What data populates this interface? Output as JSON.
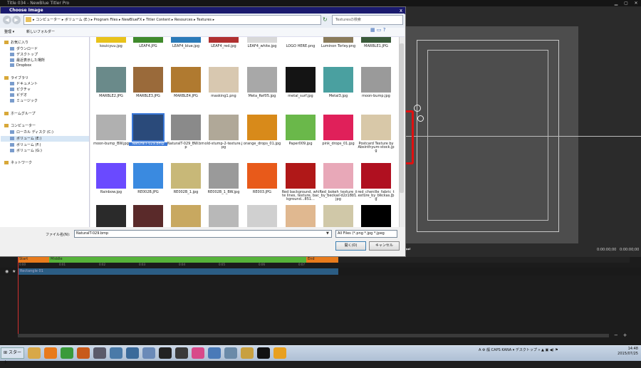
{
  "app": {
    "title": "Title 034 - NewBlue Titler Pro",
    "timecode_1": "0:00:00;00",
    "timecode_2": "0:00:00;00",
    "play_icon": "play-icon",
    "zoom_minus": "−",
    "zoom_plus": "+"
  },
  "timeline": {
    "start_label": "Start",
    "middle_label": "Middle",
    "end_label": "End",
    "ticks": [
      "0:00",
      "0:01",
      "0:02",
      "0:03",
      "0:04",
      "0:05",
      "0:06",
      "0:07"
    ],
    "track_name": "Rectangle 01",
    "track_color": "#2b5d84",
    "start_color": "#e87b1c",
    "middle_color": "#56b33a",
    "end_color": "#e87b1c"
  },
  "dialog": {
    "title": "Choose Image",
    "close": "x",
    "path": "▸ コンピューター ▸ ボリューム (E:) ▸ Program Files ▸ NewBlueFX ▸ Titler Content ▸ Resources ▸ Textures ▸",
    "search_placeholder": "Texturesの検索",
    "organize": "整理 ▾",
    "new_folder": "新しいフォルダー",
    "filename_label": "ファイル名(N):",
    "filename_value": "NaturalT-029.bmp",
    "filter_value": "All Files (*.png *.jpg *.jpeg",
    "open_button": "開く(O)",
    "cancel_button": "キャンセル"
  },
  "nav": [
    {
      "label": "お気に入り",
      "indent": 0,
      "icon": "star-icon"
    },
    {
      "label": "ダウンロード",
      "indent": 1,
      "icon": "download-folder-icon"
    },
    {
      "label": "デスクトップ",
      "indent": 1,
      "icon": "desktop-icon"
    },
    {
      "label": "最近表示した場所",
      "indent": 1,
      "icon": "recent-places-icon"
    },
    {
      "label": "Dropbox",
      "indent": 1,
      "icon": "dropbox-icon"
    },
    {
      "label": "ライブラリ",
      "indent": 0,
      "icon": "library-icon"
    },
    {
      "label": "ドキュメント",
      "indent": 1,
      "icon": "documents-icon"
    },
    {
      "label": "ピクチャ",
      "indent": 1,
      "icon": "pictures-icon"
    },
    {
      "label": "ビデオ",
      "indent": 1,
      "icon": "videos-icon"
    },
    {
      "label": "ミュージック",
      "indent": 1,
      "icon": "music-icon"
    },
    {
      "label": "ホームグループ",
      "indent": 0,
      "icon": "homegroup-icon"
    },
    {
      "label": "コンピューター",
      "indent": 0,
      "icon": "computer-icon"
    },
    {
      "label": "ローカル ディスク (C:)",
      "indent": 1,
      "icon": "drive-icon"
    },
    {
      "label": "ボリューム (E:)",
      "indent": 1,
      "icon": "drive-icon"
    },
    {
      "label": "ボリューム (F:)",
      "indent": 1,
      "icon": "drive-icon"
    },
    {
      "label": "ボリューム (G:)",
      "indent": 1,
      "icon": "drive-icon"
    },
    {
      "label": "ネットワーク",
      "indent": 0,
      "icon": "network-icon"
    }
  ],
  "files": [
    {
      "name": "kouicyuu.jpg",
      "color": "#e8c21a"
    },
    {
      "name": "LEAF4.JPG",
      "color": "#3f8a2c"
    },
    {
      "name": "LEAF4_blue.jpg",
      "color": "#2a7ab8"
    },
    {
      "name": "LEAF4_red.jpg",
      "color": "#b03030"
    },
    {
      "name": "LEAF4_white.jpg",
      "color": "#d8d8d8"
    },
    {
      "name": "LOGO HERE.png",
      "color": "#ffffff"
    },
    {
      "name": "Luminon Torley.png",
      "color": "#8a7b5a"
    },
    {
      "name": "MARBLE1.JPG",
      "color": "#3a5a3a"
    },
    {
      "name": "MARBLE2.JPG",
      "color": "#6a8a8a"
    },
    {
      "name": "MARBLE3.JPG",
      "color": "#9a6a3a"
    },
    {
      "name": "MARBLE4.JPG",
      "color": "#b07a30"
    },
    {
      "name": "masking1.png",
      "color": "#d8c8b0"
    },
    {
      "name": "Meta_Ref05.jpg",
      "color": "#a8a8a8"
    },
    {
      "name": "metal_surf.jpg",
      "color": "#141414"
    },
    {
      "name": "Metal3.jpg",
      "color": "#4aa0a0"
    },
    {
      "name": "moon-bump.jpg",
      "color": "#9a9a9a"
    },
    {
      "name": "moon-bump_BW.jpg",
      "color": "#b0b0b0"
    },
    {
      "name": "NaturalT-029.bmp",
      "color": "#2a4a7a"
    },
    {
      "name": "NaturalT-029_BW.bmp",
      "color": "#8a8a8a"
    },
    {
      "name": "old-stump-2-texture.jpg",
      "color": "#b0a898"
    },
    {
      "name": "orange_drops_01.jpg",
      "color": "#d88a1a"
    },
    {
      "name": "Paper009.jpg",
      "color": "#6ab84a"
    },
    {
      "name": "pink_drops_01.jpg",
      "color": "#e0205a"
    },
    {
      "name": "Postcard Texture by Absinthyum-stock.jpg",
      "color": "#d8c8a8"
    },
    {
      "name": "Rainbow.jpg",
      "color": "#6a4aff"
    },
    {
      "name": "RE002B.JPG",
      "color": "#3a8ae0"
    },
    {
      "name": "RE002B_1.jpg",
      "color": "#c8b878"
    },
    {
      "name": "RE002B_1_BW.jpg",
      "color": "#9a9a9a"
    },
    {
      "name": "RE003.JPG",
      "color": "#e85a1a"
    },
    {
      "name": "Red background, white lines, texture, background...851...",
      "color": "#b01818"
    },
    {
      "name": "Red_bokeh_texture_ii_by_beckas-d2z18b1.jpg",
      "color": "#e8a8b8"
    },
    {
      "name": "red_chenille_fabric_texture_by_beckas.jpg",
      "color": "#b01020"
    },
    {
      "name": "",
      "color": "#2a2a2a"
    },
    {
      "name": "",
      "color": "#5a2a2a"
    },
    {
      "name": "",
      "color": "#c8a860"
    },
    {
      "name": "",
      "color": "#b8b8b8"
    },
    {
      "name": "",
      "color": "#d0d0d0"
    },
    {
      "name": "",
      "color": "#e0b890"
    },
    {
      "name": "",
      "color": "#d0c8a8"
    },
    {
      "name": "",
      "color": "#000000"
    }
  ],
  "taskbar": {
    "start": "スタート",
    "apps": [
      {
        "icon": "explorer-icon",
        "color": "#d8a848"
      },
      {
        "icon": "firefox-icon",
        "color": "#e87a1c"
      },
      {
        "icon": "chrome-icon",
        "color": "#3a9a3a"
      },
      {
        "icon": "firefox2-icon",
        "color": "#c85a1a"
      },
      {
        "icon": "app-icon",
        "color": "#5a5a6a"
      },
      {
        "icon": "bird-icon",
        "color": "#4a7aa8"
      },
      {
        "icon": "tool-icon",
        "color": "#3a6a9a"
      },
      {
        "icon": "window-icon",
        "color": "#6a8ab8"
      },
      {
        "icon": "console-icon",
        "color": "#222222"
      },
      {
        "icon": "phone-icon",
        "color": "#3a3a3a"
      },
      {
        "icon": "paint-icon",
        "color": "#d84a8a"
      },
      {
        "icon": "monitor-icon",
        "color": "#4a7ab8"
      },
      {
        "icon": "j-icon",
        "color": "#6a8aa8"
      },
      {
        "icon": "folder-icon",
        "color": "#c8a040"
      },
      {
        "icon": "titler-icon",
        "color": "#111111"
      },
      {
        "icon": "media-icon",
        "color": "#e8a020"
      }
    ],
    "tray_text": "A ⚙ 般 CAPS KANA ▾ デスクトップ » ▲ ▣ ◀) ⚑",
    "time": "14:48",
    "date": "2015/07/25"
  }
}
